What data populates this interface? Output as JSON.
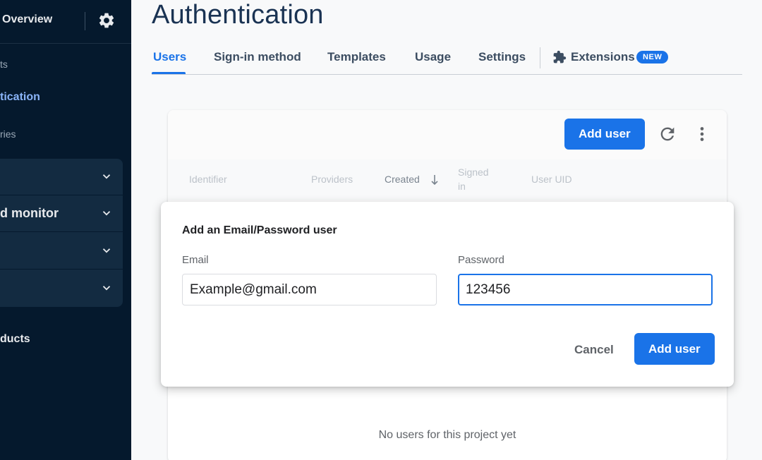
{
  "sidebar": {
    "overview_label": "Overview",
    "items": [
      {
        "label": "ts"
      },
      {
        "label": "tication"
      },
      {
        "label": "ries"
      }
    ],
    "groups": [
      {
        "label": ""
      },
      {
        "label": "d monitor"
      },
      {
        "label": ""
      },
      {
        "label": ""
      }
    ],
    "products_label": "ducts"
  },
  "page": {
    "title": "Authentication"
  },
  "tabs": [
    {
      "label": "Users",
      "active": true
    },
    {
      "label": "Sign-in method"
    },
    {
      "label": "Templates"
    },
    {
      "label": "Usage"
    },
    {
      "label": "Settings"
    },
    {
      "label": "Extensions",
      "badge": "NEW"
    }
  ],
  "card": {
    "add_user_label": "Add user",
    "columns": [
      "Identifier",
      "Providers",
      "Created",
      "Signed in",
      "User UID"
    ],
    "signed_in_lines": [
      "Signed",
      "in"
    ],
    "empty_message": "No users for this project yet"
  },
  "dialog": {
    "title": "Add an Email/Password user",
    "email_label": "Email",
    "email_value": "Example@gmail.com",
    "password_label": "Password",
    "password_value": "123456",
    "cancel_label": "Cancel",
    "submit_label": "Add user"
  },
  "colors": {
    "sidebar_bg": "#05192d",
    "accent": "#1a73e8",
    "title": "#1a3353"
  }
}
